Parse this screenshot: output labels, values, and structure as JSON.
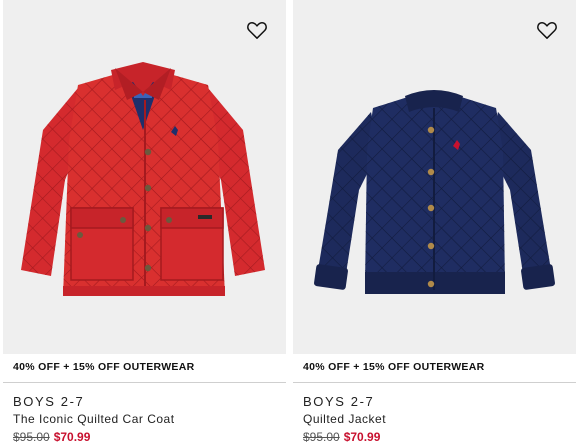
{
  "colors": {
    "sale": "#c8102e",
    "card_bg": "#efefef"
  },
  "products": [
    {
      "promo": "40% OFF + 15% OFF OUTERWEAR",
      "category": "BOYS 2-7",
      "title": "The Iconic Quilted Car Coat",
      "price_original": "$95.00",
      "price_sale": "$70.99",
      "wishlist_icon": "heart-outline-icon",
      "color": "red"
    },
    {
      "promo": "40% OFF + 15% OFF OUTERWEAR",
      "category": "BOYS 2-7",
      "title": "Quilted Jacket",
      "price_original": "$95.00",
      "price_sale": "$70.99",
      "wishlist_icon": "heart-outline-icon",
      "color": "navy"
    }
  ]
}
